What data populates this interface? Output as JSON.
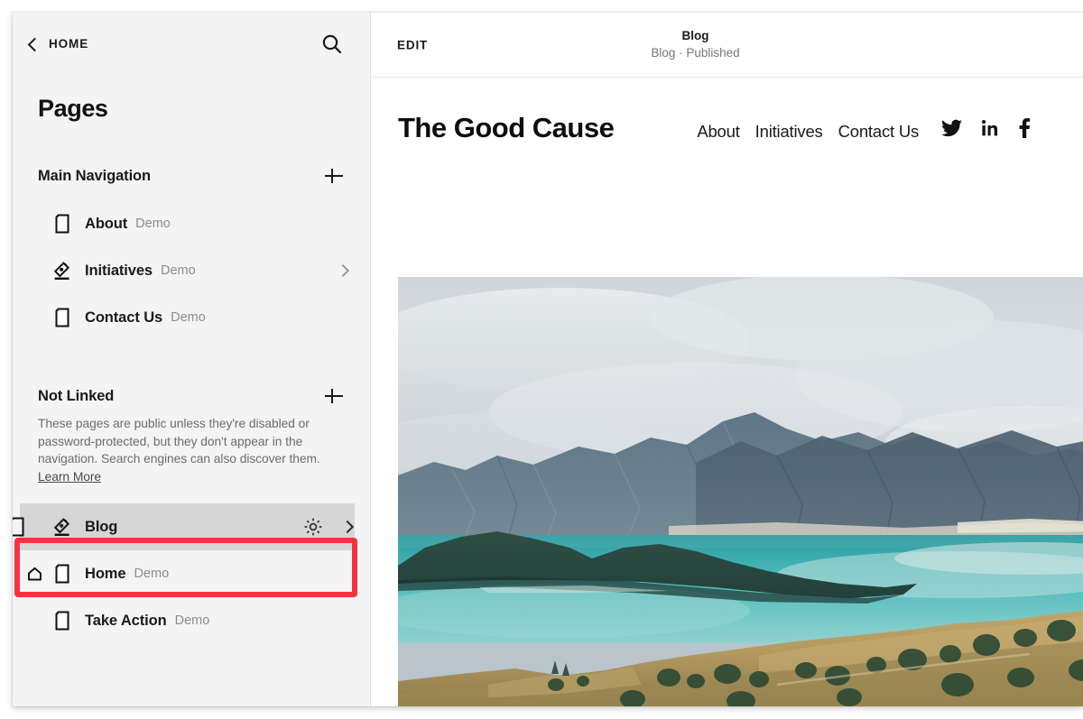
{
  "sidebar": {
    "back_label": "HOME",
    "back_icon": "chevron-left-icon",
    "search_icon": "search-icon",
    "title": "Pages",
    "sections": [
      {
        "key": "main_navigation",
        "title": "Main Navigation",
        "add_icon": "plus-icon",
        "items": [
          {
            "label": "About",
            "badge": "Demo",
            "icon": "page-document-icon",
            "has_chevron": false,
            "is_home": false
          },
          {
            "label": "Initiatives",
            "badge": "Demo",
            "icon": "blog-pen-icon",
            "has_chevron": true,
            "is_home": false
          },
          {
            "label": "Contact Us",
            "badge": "Demo",
            "icon": "page-document-icon",
            "has_chevron": false,
            "is_home": false
          }
        ]
      },
      {
        "key": "not_linked",
        "title": "Not Linked",
        "add_icon": "plus-icon",
        "description": "These pages are public unless they're disabled or password-protected, but they don't appear in the navigation. Search engines can also discover them.",
        "learn_more_label": "Learn More",
        "items": [
          {
            "label": "Blog",
            "badge": "",
            "icon": "blog-pen-icon",
            "has_chevron": true,
            "has_gear": true,
            "selected": true,
            "is_home": false
          },
          {
            "label": "Home",
            "badge": "Demo",
            "icon": "page-document-icon",
            "has_chevron": false,
            "is_home": true
          },
          {
            "label": "Take Action",
            "badge": "Demo",
            "icon": "page-document-icon",
            "has_chevron": false,
            "is_home": false
          }
        ]
      }
    ],
    "highlight_color": "#f63440",
    "selected_row_bg": "#d6d6d6"
  },
  "preview": {
    "edit_label": "EDIT",
    "page_title": "Blog",
    "page_status": "Blog · Published"
  },
  "site": {
    "logo": "The Good Cause",
    "nav": [
      {
        "label": "About"
      },
      {
        "label": "Initiatives"
      },
      {
        "label": "Contact Us"
      }
    ],
    "social": [
      {
        "name": "twitter-icon"
      },
      {
        "name": "linkedin-icon"
      },
      {
        "name": "facebook-icon"
      }
    ],
    "hero_alt": "Turquoise alpine lake with mountain range and golden grassland foreground"
  }
}
